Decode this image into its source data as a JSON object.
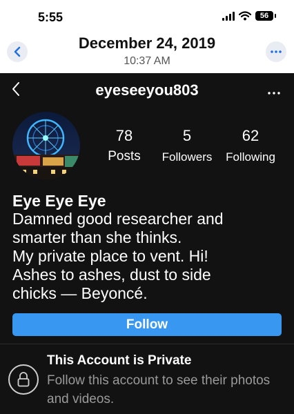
{
  "status_bar": {
    "time": "5:55",
    "battery": "56"
  },
  "header": {
    "date": "December 24, 2019",
    "time": "10:37 AM"
  },
  "profile": {
    "username": "eyeseeyou803",
    "stats": {
      "posts": {
        "value": "78",
        "label": "Posts"
      },
      "followers": {
        "value": "5",
        "label": "Followers"
      },
      "following": {
        "value": "62",
        "label": "Following"
      }
    },
    "display_name": "Eye Eye Eye",
    "bio_lines": [
      "Damned good researcher and",
      "smarter than she thinks.",
      "My private place to vent. Hi!",
      "Ashes to ashes, dust to side",
      "chicks — Beyoncé."
    ],
    "follow_label": "Follow",
    "private_title": "This Account is Private",
    "private_text": "Follow this account to see their photos and videos."
  },
  "colors": {
    "accent": "#3897f0",
    "panel_bg": "#121212",
    "muted_text": "#9a9a9a",
    "ios_blue": "#1f6fe0"
  },
  "icons": [
    "back-chevron-icon",
    "more-dots-icon",
    "lock-icon",
    "signal-icon",
    "wifi-icon",
    "battery-icon"
  ]
}
